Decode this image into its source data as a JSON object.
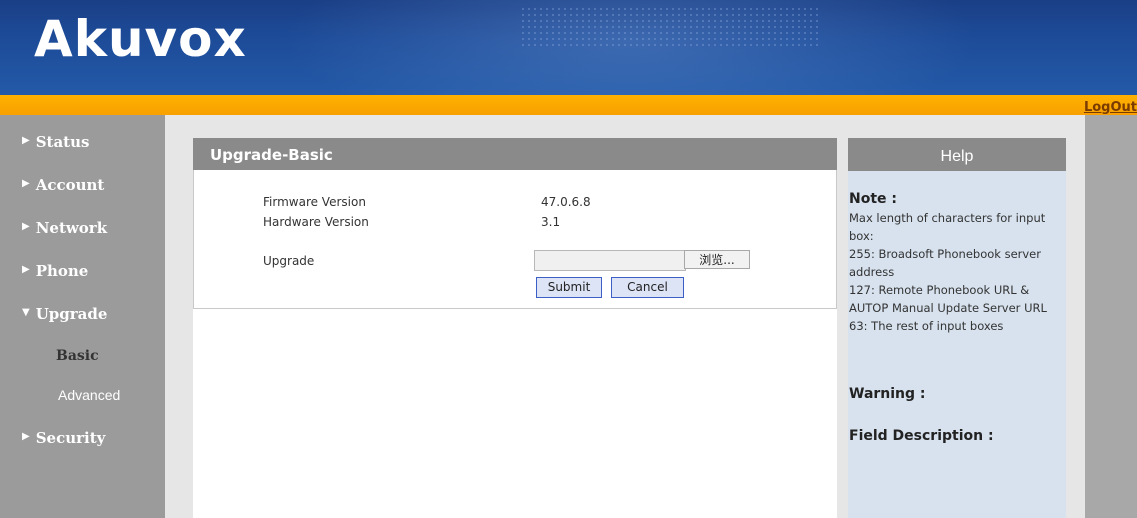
{
  "header": {
    "logo": "Akuvox",
    "logout": "LogOut"
  },
  "sidebar": {
    "items": [
      {
        "label": "Status"
      },
      {
        "label": "Account"
      },
      {
        "label": "Network"
      },
      {
        "label": "Phone"
      },
      {
        "label": "Upgrade",
        "expanded": true
      },
      {
        "label": "Security"
      }
    ],
    "sub_items": [
      {
        "label": "Basic",
        "active": true
      },
      {
        "label": "Advanced"
      }
    ]
  },
  "main": {
    "title": "Upgrade-Basic",
    "fields": {
      "firmware_label": "Firmware Version",
      "firmware_value": "47.0.6.8",
      "hardware_label": "Hardware Version",
      "hardware_value": "3.1",
      "upgrade_label": "Upgrade"
    },
    "browse_label": "浏览...",
    "submit_label": "Submit",
    "cancel_label": "Cancel"
  },
  "help": {
    "title": "Help",
    "note_heading": "Note :",
    "note_line1": "Max length of characters for input box:",
    "note_line2": "255: Broadsoft Phonebook server address",
    "note_line3": "127: Remote Phonebook URL & AUTOP Manual Update Server URL",
    "note_line4": "63: The rest of input boxes",
    "warning_heading": "Warning :",
    "field_desc_heading": "Field Description :"
  },
  "colors": {
    "header_blue": "#1d4b98",
    "orange_bar": "#ffb100",
    "sidebar_gray": "#9b9b9b",
    "panel_header_gray": "#8a8a8a",
    "help_bg": "#d7e2ee"
  }
}
